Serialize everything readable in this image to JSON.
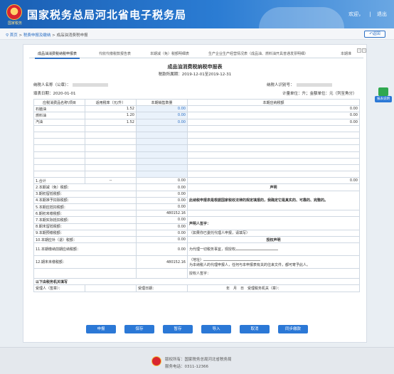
{
  "header": {
    "title": "国家税务总局河北省电子税务局",
    "emblem_text": "国家税务",
    "welcome": "欢迎，",
    "sep": "|",
    "logout": "退出"
  },
  "breadcrumb": {
    "home": "首页",
    "item1": "税费申报及缴纳",
    "item2": "成品油消费税申报",
    "back": "返回"
  },
  "tabs": [
    "成品油消费税纳税申报表",
    "代收代缴税款报告表",
    "本期减（免）税额明细表",
    "生产企业生产经营情况表（成品油、燃料油开具普通发票明细）",
    "本期准予扣除税额计算表",
    "本期准"
  ],
  "tabnav": {
    "prev": "‹",
    "next": "›"
  },
  "form": {
    "title": "成品油消费税纳税申报表",
    "period": "税款所属期：2019-12-01至2019-12-31",
    "taxpayer_name_label": "纳税人名称（公章）：",
    "taxpayer_id_label": "纳税人识别号：",
    "fill_date": "填表日期：2020-01-01",
    "unit_note": "计量单位：升；金额单位：元（列至角分）"
  },
  "table": {
    "col_headers": [
      "应税消费品名称\\项目",
      "适用税率（元/升）",
      "本期销售数量",
      "本期应纳税额"
    ],
    "rows": [
      {
        "name": "石脑油",
        "rate": "1.52",
        "qty": "0.00",
        "tax": "0.00"
      },
      {
        "name": "燃料油",
        "rate": "1.20",
        "qty": "0.00",
        "tax": "0.00"
      },
      {
        "name": "汽油",
        "rate": "1.52",
        "qty": "0.00",
        "tax": "0.00"
      }
    ],
    "total_label": "1.合计",
    "total_rate": "--",
    "total_qty": "0.00",
    "total_tax": "0.00",
    "lines": [
      {
        "label": "2.本期减（免）税额：",
        "value": "0.00"
      },
      {
        "label": "3.期初留抵税额：",
        "value": "0.00"
      },
      {
        "label": "4.本期准予扣除税额：",
        "value": "0.00"
      },
      {
        "label": "5.本期应抵扣税额：",
        "value": "0.00"
      },
      {
        "label": "6.期初未缴税额：",
        "value": "480152.16"
      },
      {
        "label": "7.本期实际抵扣税额：",
        "value": "0.00"
      },
      {
        "label": "8.期末留抵税额：",
        "value": "0.00"
      },
      {
        "label": "9.本期预缴税额：",
        "value": "0.00"
      },
      {
        "label": "10.本期应补（退）税额：",
        "value": "0.00"
      },
      {
        "label": "11.本期缴纳前期应纳税额：",
        "value": "0.00"
      },
      {
        "label": "12.期末未缴税额：",
        "value": "480152.16"
      }
    ],
    "declaration_title": "声明",
    "declaration_text": "此纳税申报表是根据国家税收法律的规定填报的，我确定它是真实的、可靠的、完整的。",
    "declarant_sign": "声明人签字：",
    "agent_note": "（如果你已委托代理人申报，请填写）",
    "auth_title": "授权声明",
    "auth_text1": "为代理一切税务事宜，现授权",
    "auth_addr": "（地址）",
    "auth_text2": "为本纳税人的代理申报人，任何与本申报表有关的往来文件，都可寄予此人。",
    "auth_sign": "授权人签字：",
    "office_label": "以下由税务机关填写",
    "receiver_label": "受理人（签章）：",
    "receive_date_label": "受理日期：",
    "ymd": "年　月　日",
    "office_seal_label": "受理税务机关（章）："
  },
  "buttons": [
    "申报",
    "保存",
    "暂存",
    "导入",
    "取消",
    "同步缴款"
  ],
  "helper": {
    "label": "报表说明"
  },
  "footer": {
    "line1": "版权所有：国家税务总局河北省税务局",
    "line2": "服务电话：0311-12366"
  }
}
